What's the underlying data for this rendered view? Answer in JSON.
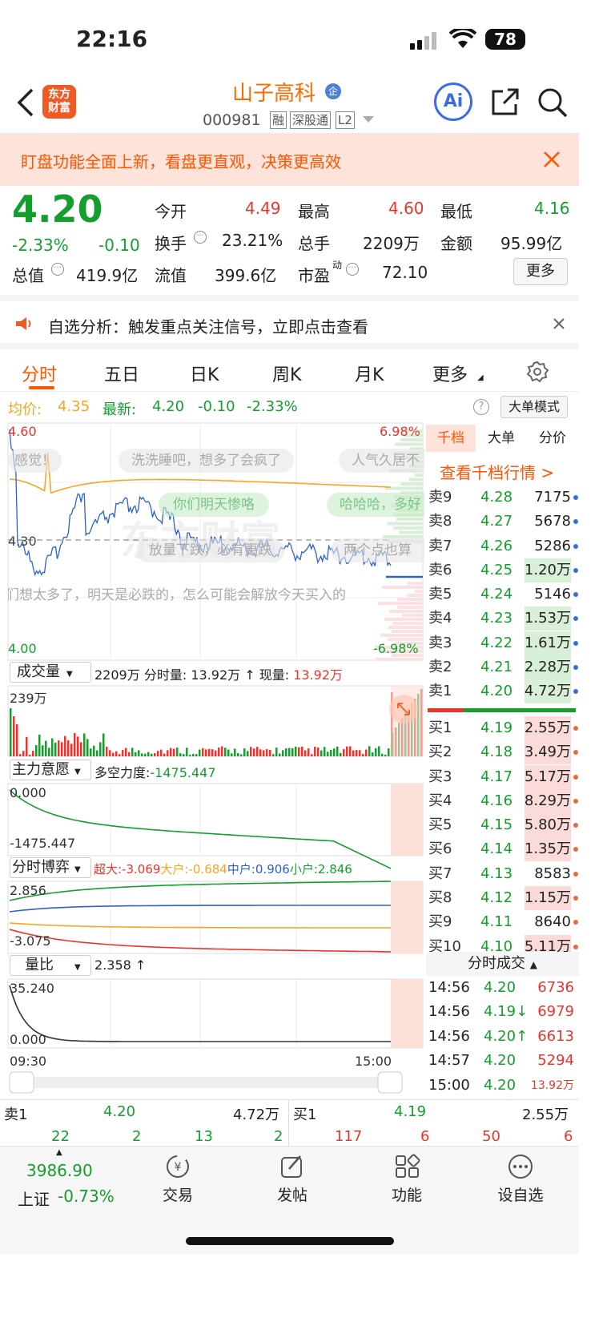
{
  "status": {
    "time": "22:16",
    "battery": "78"
  },
  "header": {
    "logo_line1": "东方",
    "logo_line2": "财富",
    "stock_name": "山子高科",
    "name_badge": "企",
    "code": "000981",
    "tag1": "融",
    "tag2": "深股通",
    "tag3": "L2",
    "ai_label": "Ai"
  },
  "banner": {
    "text": "盯盘功能全面上新，看盘更直观，决策更高效"
  },
  "quote": {
    "price": "4.20",
    "change_pct": "-2.33%",
    "change": "-0.10",
    "open_label": "今开",
    "open": "4.49",
    "high_label": "最高",
    "high": "4.60",
    "low_label": "最低",
    "low": "4.16",
    "turnover_label": "换手",
    "turnover": "23.21%",
    "volume_label": "总手",
    "volume": "2209万",
    "amount_label": "金额",
    "amount": "95.99亿",
    "mcap_label": "总值",
    "mcap": "419.9亿",
    "float_label": "流值",
    "float": "399.6亿",
    "pe_label": "市盈",
    "pe_sup": "动",
    "pe": "72.10",
    "more": "更多"
  },
  "notice": {
    "text": "自选分析：触发重点关注信号，立即点击查看"
  },
  "tabs": [
    "分时",
    "五日",
    "日K",
    "周K",
    "月K",
    "更多"
  ],
  "legend": {
    "avg_label": "均价:",
    "avg": "4.35",
    "last_label": "最新:",
    "last": "4.20",
    "chg": "-0.10",
    "pct": "-2.33%",
    "help": "?",
    "mode": "大单模式"
  },
  "chart": {
    "ymax": "4.60",
    "ymid": "4.30",
    "ymin": "4.00",
    "pmax": "6.98%",
    "pmin": "-6.98%",
    "time_start": "09:30",
    "time_end": "15:00",
    "danmu": [
      "感觉！",
      "洗洗睡吧，想多了会疯了",
      "人气久居不",
      "你们明天惨咯",
      "哈哈哈，多好",
      "放量下跌，必有更跌",
      "两个点也算",
      "你们想太多了，明天是必跌的，怎么可能会解放今天买入的"
    ],
    "watermark": "东方财富"
  },
  "vol": {
    "label": "成交量",
    "total": "2209万",
    "min_label": "分时量:",
    "min": "13.92万",
    "arrow": "↑",
    "now_label": "现量:",
    "now": "13.92万",
    "ymax": "239万"
  },
  "will": {
    "label": "主力意愿",
    "text_label": "多空力度:",
    "value": "-1475.447",
    "ymax": "0.000",
    "ymin": "-1475.447"
  },
  "game": {
    "label": "分时博弈",
    "s1": "超大:-3.069",
    "s2": "大户:-0.684",
    "s3": "中户:0.906",
    "s4": "小户:2.846",
    "ymax": "2.856",
    "ymin": "-3.075"
  },
  "ratio": {
    "label": "量比",
    "value": "2.358",
    "arrow": "↑",
    "ymax": "35.240",
    "ymin": "0.000"
  },
  "side_tabs": [
    "千档",
    "大单",
    "分价"
  ],
  "side_link": "查看千档行情 >",
  "asks": [
    {
      "l": "卖9",
      "p": "4.28",
      "v": "7175"
    },
    {
      "l": "卖8",
      "p": "4.27",
      "v": "5678"
    },
    {
      "l": "卖7",
      "p": "4.26",
      "v": "5286"
    },
    {
      "l": "卖6",
      "p": "4.25",
      "v": "1.20万"
    },
    {
      "l": "卖5",
      "p": "4.24",
      "v": "5146"
    },
    {
      "l": "卖4",
      "p": "4.23",
      "v": "1.53万"
    },
    {
      "l": "卖3",
      "p": "4.22",
      "v": "1.61万"
    },
    {
      "l": "卖2",
      "p": "4.21",
      "v": "2.28万"
    },
    {
      "l": "卖1",
      "p": "4.20",
      "v": "4.72万"
    }
  ],
  "bids": [
    {
      "l": "买1",
      "p": "4.19",
      "v": "2.55万"
    },
    {
      "l": "买2",
      "p": "4.18",
      "v": "3.49万"
    },
    {
      "l": "买3",
      "p": "4.17",
      "v": "5.17万"
    },
    {
      "l": "买4",
      "p": "4.16",
      "v": "8.29万"
    },
    {
      "l": "买5",
      "p": "4.15",
      "v": "5.80万"
    },
    {
      "l": "买6",
      "p": "4.14",
      "v": "1.35万"
    },
    {
      "l": "买7",
      "p": "4.13",
      "v": "8583"
    },
    {
      "l": "买8",
      "p": "4.12",
      "v": "1.15万"
    },
    {
      "l": "买9",
      "p": "4.11",
      "v": "8640"
    },
    {
      "l": "买10",
      "p": "4.10",
      "v": "5.11万"
    }
  ],
  "trades_title": "分时成交",
  "trades": [
    {
      "t": "14:56",
      "p": "4.20",
      "v": "6736"
    },
    {
      "t": "14:56",
      "p": "4.19↓",
      "v": "6979"
    },
    {
      "t": "14:56",
      "p": "4.20↑",
      "v": "6613"
    },
    {
      "t": "14:57",
      "p": "4.20",
      "v": "5294"
    },
    {
      "t": "15:00",
      "p": "4.20",
      "v": "13.92万"
    }
  ],
  "bottom_quote": {
    "sell_label": "卖1",
    "sell_price": "4.20",
    "sell_vol": "4.72万",
    "buy_label": "买1",
    "buy_price": "4.19",
    "buy_vol": "2.55万",
    "left_nums": [
      "22",
      "2",
      "13",
      "2"
    ],
    "right_nums": [
      "117",
      "6",
      "50",
      "6"
    ]
  },
  "tabbar": {
    "index_value": "3986.90",
    "index_name": "上证",
    "index_pct": "-0.73%",
    "items": [
      "交易",
      "发帖",
      "功能",
      "设自选"
    ]
  },
  "colors": {
    "up": "#e8352d",
    "down": "#149e2e",
    "avg": "#f5a623",
    "accent": "#ff6a00",
    "price_line": "#2d62c9"
  }
}
